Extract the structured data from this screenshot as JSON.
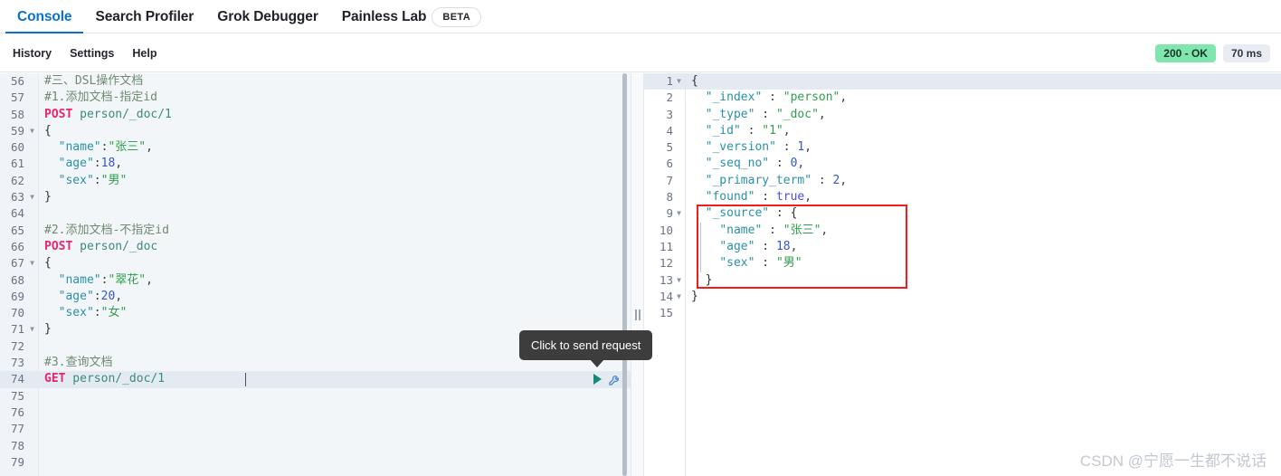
{
  "tabs": [
    {
      "label": "Console",
      "active": true
    },
    {
      "label": "Search Profiler",
      "active": false
    },
    {
      "label": "Grok Debugger",
      "active": false
    },
    {
      "label": "Painless Lab",
      "active": false
    }
  ],
  "beta_badge": "BETA",
  "submenu": [
    {
      "label": "History"
    },
    {
      "label": "Settings"
    },
    {
      "label": "Help"
    }
  ],
  "status": {
    "code": "200 - OK",
    "time": "70 ms"
  },
  "colors": {
    "accent": "#0a72c4",
    "status_ok_bg": "#7fe6ad",
    "status_time_bg": "#e9edf3",
    "annotation_red": "#f31b1b",
    "tooltip_bg": "#3d3d3d",
    "play_teal": "#118a78",
    "wrench_blue": "#4a86c8"
  },
  "tooltip": {
    "text": "Click to send request"
  },
  "watermark": "CSDN @宁愿一生都不说话",
  "editor": {
    "first_line": 56,
    "last_line": 79,
    "active_line": 74,
    "lines": [
      {
        "n": 56,
        "fold": false,
        "text": "#三、DSL操作文档",
        "kind": "comment"
      },
      {
        "n": 57,
        "fold": false,
        "text": "#1.添加文档-指定id",
        "kind": "comment"
      },
      {
        "n": 58,
        "fold": false,
        "text": "POST person/_doc/1",
        "kind": "request",
        "method": "POST",
        "path": "person/_doc/1"
      },
      {
        "n": 59,
        "fold": true,
        "text": "{",
        "kind": "brace"
      },
      {
        "n": 60,
        "fold": false,
        "text": "  \"name\":\"张三\",",
        "kind": "pair",
        "key": "\"name\"",
        "value": "\"张三\"",
        "vtype": "string",
        "trail": ","
      },
      {
        "n": 61,
        "fold": false,
        "text": "  \"age\":18,",
        "kind": "pair",
        "key": "\"age\"",
        "value": "18",
        "vtype": "num",
        "trail": ","
      },
      {
        "n": 62,
        "fold": false,
        "text": "  \"sex\":\"男\"",
        "kind": "pair",
        "key": "\"sex\"",
        "value": "\"男\"",
        "vtype": "string",
        "trail": ""
      },
      {
        "n": 63,
        "fold": true,
        "text": "}",
        "kind": "brace"
      },
      {
        "n": 64,
        "fold": false,
        "text": "",
        "kind": "blank"
      },
      {
        "n": 65,
        "fold": false,
        "text": "#2.添加文档-不指定id",
        "kind": "comment"
      },
      {
        "n": 66,
        "fold": false,
        "text": "POST person/_doc",
        "kind": "request",
        "method": "POST",
        "path": "person/_doc"
      },
      {
        "n": 67,
        "fold": true,
        "text": "{",
        "kind": "brace"
      },
      {
        "n": 68,
        "fold": false,
        "text": "  \"name\":\"翠花\",",
        "kind": "pair",
        "key": "\"name\"",
        "value": "\"翠花\"",
        "vtype": "string",
        "trail": ","
      },
      {
        "n": 69,
        "fold": false,
        "text": "  \"age\":20,",
        "kind": "pair",
        "key": "\"age\"",
        "value": "20",
        "vtype": "num",
        "trail": ","
      },
      {
        "n": 70,
        "fold": false,
        "text": "  \"sex\":\"女\"",
        "kind": "pair",
        "key": "\"sex\"",
        "value": "\"女\"",
        "vtype": "string",
        "trail": ""
      },
      {
        "n": 71,
        "fold": true,
        "text": "}",
        "kind": "brace"
      },
      {
        "n": 72,
        "fold": false,
        "text": "",
        "kind": "blank"
      },
      {
        "n": 73,
        "fold": false,
        "text": "#3.查询文档",
        "kind": "comment"
      },
      {
        "n": 74,
        "fold": false,
        "text": "GET person/_doc/1",
        "kind": "request",
        "method": "GET",
        "path": "person/_doc/1"
      },
      {
        "n": 75,
        "fold": false,
        "text": "",
        "kind": "blank"
      },
      {
        "n": 76,
        "fold": false,
        "text": "",
        "kind": "blank"
      },
      {
        "n": 77,
        "fold": false,
        "text": "",
        "kind": "blank"
      },
      {
        "n": 78,
        "fold": false,
        "text": "",
        "kind": "blank"
      },
      {
        "n": 79,
        "fold": false,
        "text": "",
        "kind": "blank"
      }
    ]
  },
  "response": {
    "first_line": 1,
    "last_line": 15,
    "active_line": 1,
    "annotated_lines": [
      9,
      10,
      11,
      12,
      13
    ],
    "lines": [
      {
        "n": 1,
        "fold": true,
        "kind": "brace",
        "text": "{"
      },
      {
        "n": 2,
        "fold": false,
        "kind": "pair",
        "key": "\"_index\"",
        "value": "\"person\"",
        "vtype": "string",
        "trail": ",",
        "indent": 1
      },
      {
        "n": 3,
        "fold": false,
        "kind": "pair",
        "key": "\"_type\"",
        "value": "\"_doc\"",
        "vtype": "string",
        "trail": ",",
        "indent": 1
      },
      {
        "n": 4,
        "fold": false,
        "kind": "pair",
        "key": "\"_id\"",
        "value": "\"1\"",
        "vtype": "string",
        "trail": ",",
        "indent": 1
      },
      {
        "n": 5,
        "fold": false,
        "kind": "pair",
        "key": "\"_version\"",
        "value": "1",
        "vtype": "num",
        "trail": ",",
        "indent": 1
      },
      {
        "n": 6,
        "fold": false,
        "kind": "pair",
        "key": "\"_seq_no\"",
        "value": "0",
        "vtype": "num",
        "trail": ",",
        "indent": 1
      },
      {
        "n": 7,
        "fold": false,
        "kind": "pair",
        "key": "\"_primary_term\"",
        "value": "2",
        "vtype": "num",
        "trail": ",",
        "indent": 1
      },
      {
        "n": 8,
        "fold": false,
        "kind": "pair",
        "key": "\"found\"",
        "value": "true",
        "vtype": "bool",
        "trail": ",",
        "indent": 1
      },
      {
        "n": 9,
        "fold": true,
        "kind": "objopen",
        "key": "\"_source\"",
        "value": "{",
        "indent": 1
      },
      {
        "n": 10,
        "fold": false,
        "kind": "pair",
        "key": "\"name\"",
        "value": "\"张三\"",
        "vtype": "string",
        "trail": ",",
        "indent": 2
      },
      {
        "n": 11,
        "fold": false,
        "kind": "pair",
        "key": "\"age\"",
        "value": "18",
        "vtype": "num",
        "trail": ",",
        "indent": 2
      },
      {
        "n": 12,
        "fold": false,
        "kind": "pair",
        "key": "\"sex\"",
        "value": "\"男\"",
        "vtype": "string",
        "trail": "",
        "indent": 2
      },
      {
        "n": 13,
        "fold": true,
        "kind": "brace",
        "text": "}",
        "indent": 1
      },
      {
        "n": 14,
        "fold": true,
        "kind": "brace",
        "text": "}",
        "indent": 0
      },
      {
        "n": 15,
        "fold": false,
        "kind": "blank",
        "text": ""
      }
    ]
  },
  "icons": {
    "play": "play-icon",
    "wrench": "wrench-icon",
    "splitter": "splitter-grip-icon"
  }
}
